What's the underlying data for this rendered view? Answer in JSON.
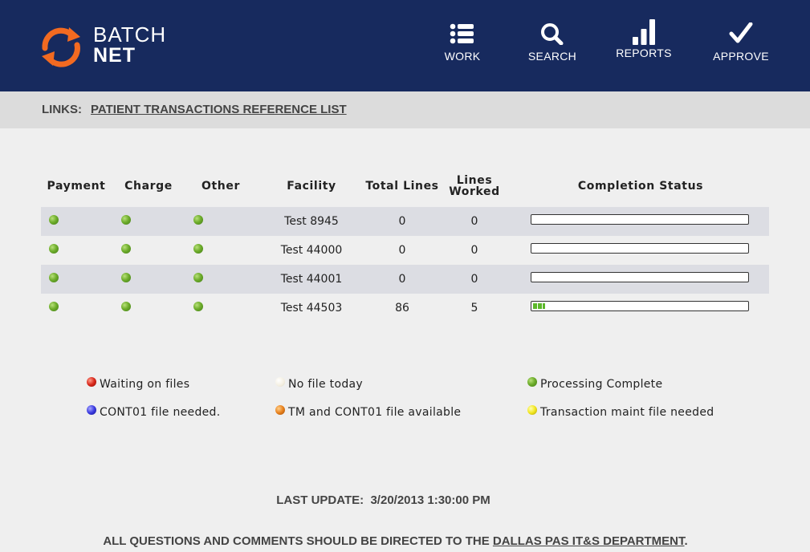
{
  "header": {
    "logo": {
      "line1": "BATCH",
      "line2": "NET"
    },
    "nav": [
      {
        "label": "WORK",
        "icon": "list-icon"
      },
      {
        "label": "SEARCH",
        "icon": "search-icon"
      },
      {
        "label": "REPORTS",
        "icon": "bar-chart-icon"
      },
      {
        "label": "APPROVE",
        "icon": "checkmark-icon"
      }
    ]
  },
  "links": {
    "label": "LINKS:",
    "items": [
      {
        "text": "PATIENT TRANSACTIONS REFERENCE LIST"
      }
    ]
  },
  "table": {
    "columns": [
      "Payment",
      "Charge",
      "Other",
      "Facility",
      "Total Lines",
      "Lines Worked",
      "Completion Status"
    ],
    "rows": [
      {
        "payment": "green",
        "charge": "green",
        "other": "green",
        "facility": "Test 8945",
        "total_lines": "0",
        "lines_worked": "0",
        "completion": 0
      },
      {
        "payment": "green",
        "charge": "green",
        "other": "green",
        "facility": "Test 44000",
        "total_lines": "0",
        "lines_worked": "0",
        "completion": 0
      },
      {
        "payment": "green",
        "charge": "green",
        "other": "green",
        "facility": "Test 44001",
        "total_lines": "0",
        "lines_worked": "0",
        "completion": 0
      },
      {
        "payment": "green",
        "charge": "green",
        "other": "green",
        "facility": "Test 44503",
        "total_lines": "86",
        "lines_worked": "5",
        "completion": 0.058
      }
    ]
  },
  "legend": [
    {
      "color": "red",
      "label": "Waiting on files"
    },
    {
      "color": "white",
      "label": "No file today"
    },
    {
      "color": "green",
      "label": "Processing Complete"
    },
    {
      "color": "blue",
      "label": "CONT01 file needed."
    },
    {
      "color": "orange",
      "label": "TM and CONT01 file available"
    },
    {
      "color": "yellow",
      "label": "Transaction maint file needed"
    }
  ],
  "footer": {
    "last_update_label": "LAST UPDATE:",
    "last_update_value": "3/20/2013 1:30:00 PM",
    "note_prefix": "ALL QUESTIONS AND COMMENTS SHOULD BE DIRECTED TO THE",
    "note_link": "DALLAS PAS IT&S DEPARTMENT",
    "note_suffix": "."
  },
  "colors": {
    "header_bg": "#172a5e",
    "logo_orange": "#f26a21",
    "links_bar_bg": "#dcdcdc",
    "row_shade": "#dcdde3",
    "progress_green": "#5cb82a"
  }
}
